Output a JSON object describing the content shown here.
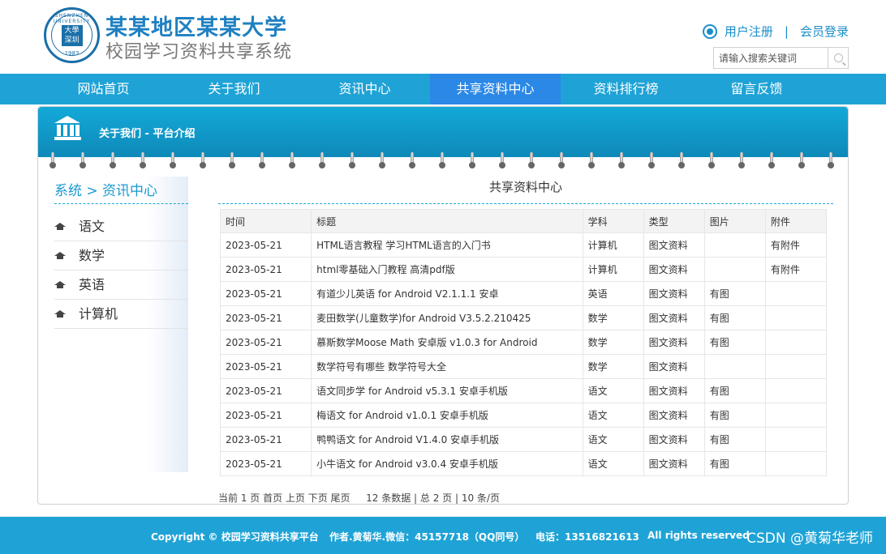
{
  "header": {
    "title1": "某某地区某某大学",
    "title2": "校园学习资料共享系统",
    "register": "用户注册",
    "separator": "|",
    "login": "会员登录",
    "search_placeholder": "请输入搜索关键词",
    "logo_top": "SHENZHEN UNIVERSITY",
    "logo_seal": "大學\n深圳",
    "logo_year": "1983"
  },
  "nav": {
    "items": [
      "网站首页",
      "关于我们",
      "资讯中心",
      "共享资料中心",
      "资料排行榜",
      "留言反馈"
    ],
    "active": "共享资料中心"
  },
  "banner": {
    "crumb": "关于我们 - 平台介绍"
  },
  "sidebar": {
    "title": "系统 > 资讯中心",
    "items": [
      "语文",
      "数学",
      "英语",
      "计算机"
    ]
  },
  "main": {
    "heading": "共享资料中心",
    "columns": [
      "时间",
      "标题",
      "学科",
      "类型",
      "图片",
      "附件"
    ],
    "rows": [
      [
        "2023-05-21",
        "HTML语言教程 学习HTML语言的入门书",
        "计算机",
        "图文资料",
        "",
        "有附件"
      ],
      [
        "2023-05-21",
        "html零基础入门教程 高清pdf版",
        "计算机",
        "图文资料",
        "",
        "有附件"
      ],
      [
        "2023-05-21",
        "有道少儿英语 for Android V2.1.1.1 安卓",
        "英语",
        "图文资料",
        "有图",
        ""
      ],
      [
        "2023-05-21",
        "麦田数学(儿童数学)for Android V3.5.2.210425",
        "数学",
        "图文资料",
        "有图",
        ""
      ],
      [
        "2023-05-21",
        "慕斯数学Moose Math 安卓版 v1.0.3 for Android",
        "数学",
        "图文资料",
        "有图",
        ""
      ],
      [
        "2023-05-21",
        "数学符号有哪些 数学符号大全",
        "数学",
        "图文资料",
        "",
        ""
      ],
      [
        "2023-05-21",
        "语文同步学 for Android v5.3.1 安卓手机版",
        "语文",
        "图文资料",
        "有图",
        ""
      ],
      [
        "2023-05-21",
        "梅语文 for Android v1.0.1 安卓手机版",
        "语文",
        "图文资料",
        "有图",
        ""
      ],
      [
        "2023-05-21",
        "鸭鸭语文 for Android V1.4.0 安卓手机版",
        "语文",
        "图文资料",
        "有图",
        ""
      ],
      [
        "2023-05-21",
        "小牛语文 for Android v3.0.4 安卓手机版",
        "语文",
        "图文资料",
        "有图",
        ""
      ]
    ],
    "pager": "当前 1 页 首页 上页 下页 尾页 　 12 条数据 | 总 2 页 | 10 条/页"
  },
  "footer": {
    "copyright": "Copyright © 校园学习资料共享平台",
    "author": "作者.黄菊华.微信：45157718（QQ同号）",
    "phone": "电话：13516821613",
    "rights": "All rights reserved",
    "watermark": "CSDN @黄菊华老师"
  }
}
